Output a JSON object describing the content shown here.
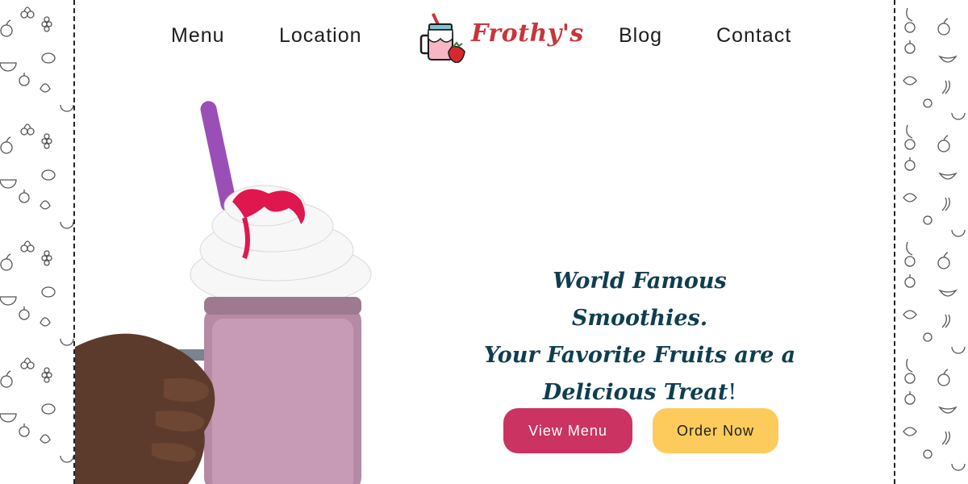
{
  "brand": {
    "name": "Frothy's",
    "logo_icon": "smoothie-jar-icon"
  },
  "nav": {
    "items": [
      {
        "label": "Menu"
      },
      {
        "label": "Location"
      },
      {
        "label": "Blog"
      },
      {
        "label": "Contact"
      }
    ]
  },
  "hero": {
    "tagline_line1": "World Famous Smoothies.",
    "tagline_line2": "Your Favorite Fruits are a",
    "tagline_line3": "Delicious Treat",
    "tagline_bang": "!",
    "image": "smoothie-photo"
  },
  "buttons": {
    "view_menu": "View Menu",
    "order_now": "Order Now"
  },
  "colors": {
    "brand_red": "#c8353a",
    "tagline": "#0f3e4f",
    "view_button": "#cb3362",
    "order_button": "#fdcb5c"
  },
  "pattern": {
    "icons": [
      "apple-icon",
      "cherry-icon",
      "grape-icon",
      "lemon-icon",
      "watermelon-icon",
      "strawberry-icon",
      "pear-icon",
      "banana-icon"
    ]
  }
}
